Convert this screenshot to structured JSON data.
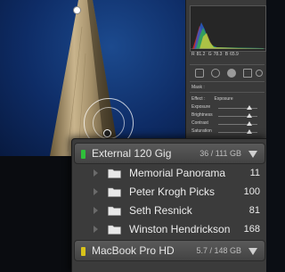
{
  "histogram": {
    "readout": {
      "r_label": "R",
      "r_value": "81.2",
      "g_label": "G",
      "g_value": "78.3",
      "b_label": "B",
      "b_value": "65.9"
    }
  },
  "mask_panel": {
    "mask_label": "Mask :",
    "effect_label": "Effect :",
    "effect_value": "Exposure",
    "sliders": [
      {
        "label": "Exposure",
        "level": 0.8
      },
      {
        "label": "Brightness",
        "level": 0.8
      },
      {
        "label": "Contrast",
        "level": 0.8
      },
      {
        "label": "Saturation",
        "level": 0.8
      }
    ]
  },
  "folders_panel": {
    "volumes": [
      {
        "name": "External 120 Gig",
        "size": "36 / 111 GB",
        "indicator_color": "#2fbf3a"
      },
      {
        "name": "MacBook Pro HD",
        "size": "5.7 / 148 GB",
        "indicator_color": "#d8c21a"
      }
    ],
    "folders": [
      {
        "name": "Memorial Panorama",
        "count": "11"
      },
      {
        "name": "Peter Krogh Picks",
        "count": "100"
      },
      {
        "name": "Seth Resnick",
        "count": "81"
      },
      {
        "name": "Winston Hendrickson",
        "count": "168"
      }
    ]
  },
  "colors": {
    "panel_bg": "#3b3b3b",
    "text": "#ececec",
    "sky": "#0e2c66"
  }
}
